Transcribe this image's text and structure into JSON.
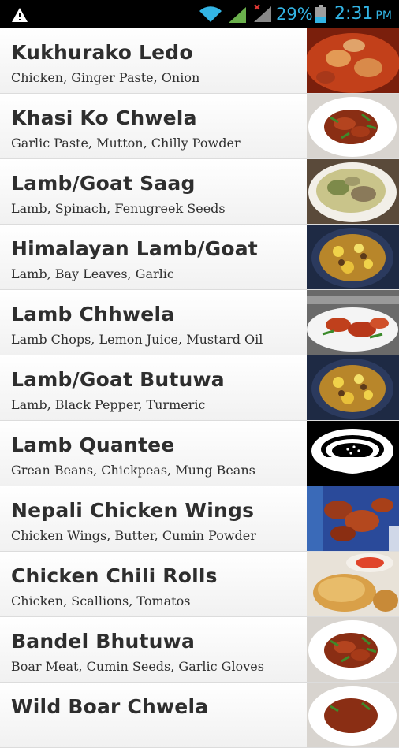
{
  "status_bar": {
    "battery_percent": "29%",
    "time": "2:31",
    "ampm": "PM"
  },
  "recipes": [
    {
      "title": "Kukhurako Ledo",
      "ingredients": "Chicken, Ginger Paste, Onion",
      "thumb": "curry-red"
    },
    {
      "title": "Khasi Ko Chwela",
      "ingredients": "Garlic Paste, Mutton, Chilly Powder",
      "thumb": "plate-meat"
    },
    {
      "title": "Lamb/Goat Saag",
      "ingredients": "Lamb, Spinach, Fenugreek Seeds",
      "thumb": "plate-saag"
    },
    {
      "title": "Himalayan Lamb/Goat",
      "ingredients": "Lamb, Bay Leaves, Garlic",
      "thumb": "bowl-yellow"
    },
    {
      "title": "Lamb Chhwela",
      "ingredients": "Lamb Chops, Lemon Juice, Mustard Oil",
      "thumb": "plate-chops"
    },
    {
      "title": "Lamb/Goat Butuwa",
      "ingredients": "Lamb, Black Pepper, Turmeric",
      "thumb": "bowl-yellow"
    },
    {
      "title": "Lamb Quantee",
      "ingredients": "Grean Beans, Chickpeas, Mung Beans",
      "thumb": "bowl-icon"
    },
    {
      "title": "Nepali Chicken Wings",
      "ingredients": "Chicken Wings, Butter, Cumin Powder",
      "thumb": "wings"
    },
    {
      "title": "Chicken Chili Rolls",
      "ingredients": "Chicken, Scallions, Tomatos",
      "thumb": "rolls"
    },
    {
      "title": "Bandel Bhutuwa",
      "ingredients": "Boar Meat, Cumin Seeds, Garlic Gloves",
      "thumb": "plate-meat"
    },
    {
      "title": "Wild Boar Chwela",
      "ingredients": "",
      "thumb": "plate-meat"
    }
  ]
}
